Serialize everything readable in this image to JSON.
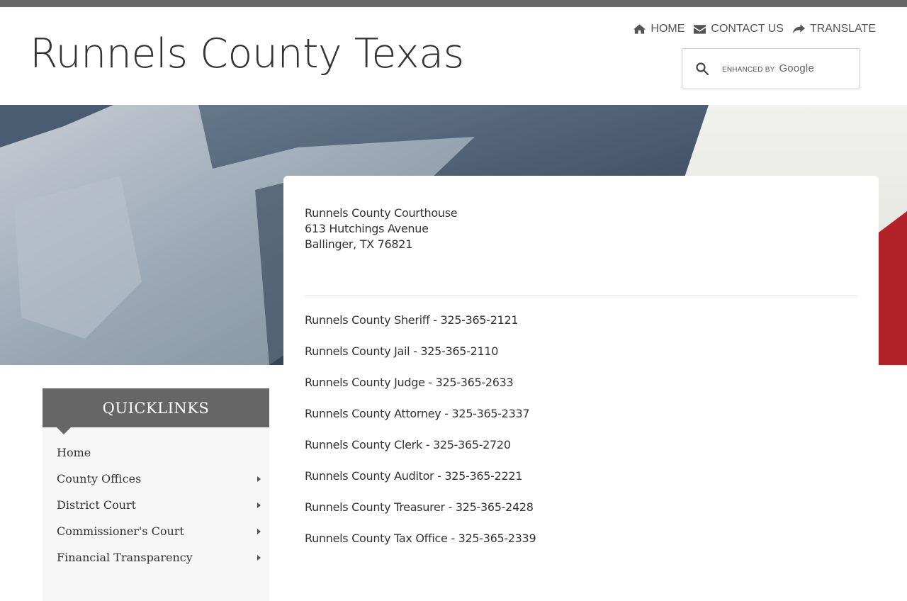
{
  "site": {
    "title": "Runnels County Texas"
  },
  "utility_nav": [
    {
      "label": "HOME",
      "icon": "home-icon"
    },
    {
      "label": "CONTACT US",
      "icon": "envelope-icon"
    },
    {
      "label": "TRANSLATE",
      "icon": "share-arrow-icon"
    }
  ],
  "search": {
    "enhanced_by": "ENHANCED BY",
    "brand": "Google",
    "icon": "search-icon"
  },
  "address": {
    "line1": "Runnels County Courthouse",
    "line2": "613 Hutchings Avenue",
    "line3": "Ballinger, TX 76821"
  },
  "contacts": [
    "Runnels County Sheriff - 325-365-2121",
    "Runnels County Jail - 325-365-2110",
    "Runnels County Judge - 325-365-2633",
    "Runnels County Attorney - 325-365-2337",
    "Runnels County Clerk - 325-365-2720",
    "Runnels County Auditor - 325-365-2221",
    "Runnels County Treasurer - 325-365-2428",
    "Runnels County Tax Office - 325-365-2339"
  ],
  "quicklinks": {
    "heading": "QUICKLINKS",
    "items": [
      {
        "label": "Home",
        "has_submenu": false
      },
      {
        "label": "County Offices",
        "has_submenu": true
      },
      {
        "label": "District Court",
        "has_submenu": true
      },
      {
        "label": "Commissioner's Court",
        "has_submenu": true
      },
      {
        "label": "Financial Transparency",
        "has_submenu": true
      }
    ]
  },
  "colors": {
    "topbar": "#666666",
    "flag_blue": "#3f5570",
    "flag_red": "#b8242a",
    "flag_white": "#ebebe8"
  }
}
